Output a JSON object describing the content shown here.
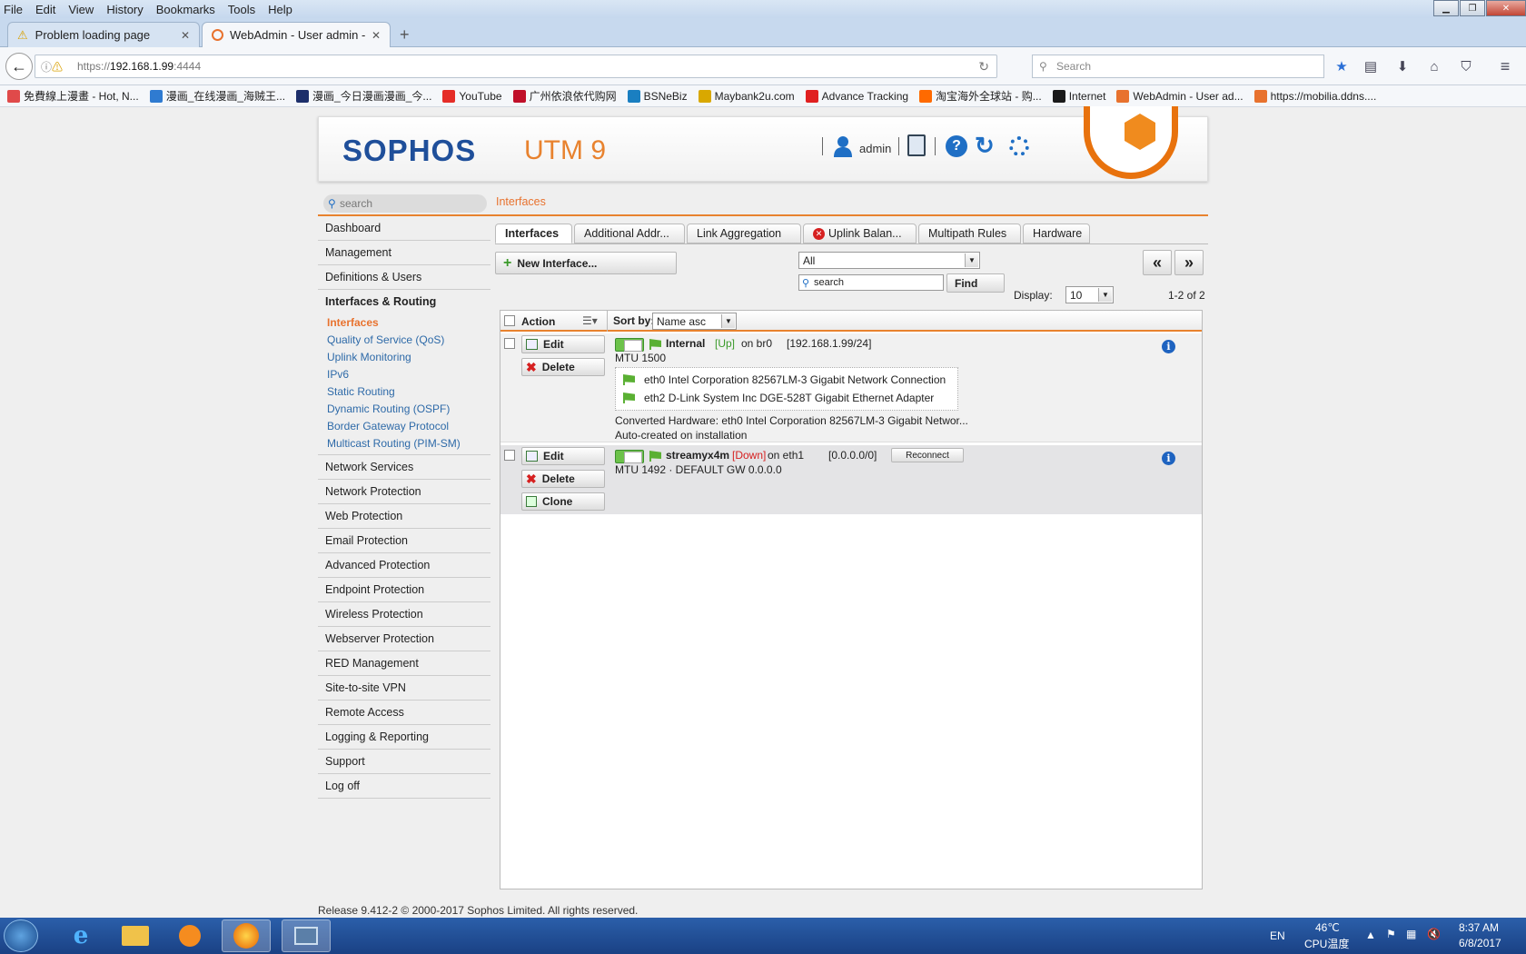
{
  "browser": {
    "menu": [
      "File",
      "Edit",
      "View",
      "History",
      "Bookmarks",
      "Tools",
      "Help"
    ],
    "tabs": [
      {
        "label": "Problem loading page"
      },
      {
        "label": "WebAdmin - User admin - D"
      }
    ],
    "url": {
      "scheme": "https://",
      "host": "192.168.1.99",
      "port": ":4444"
    },
    "search_placeholder": "Search",
    "bookmarks": [
      {
        "label": "免費線上漫畫 - Hot, N...",
        "color": "#e04a4a"
      },
      {
        "label": "漫画_在线漫画_海贼王...",
        "color": "#2f7bd1"
      },
      {
        "label": "漫画_今日漫画漫画_今...",
        "color": "#1d2f6b"
      },
      {
        "label": "YouTube",
        "color": "#e52d27"
      },
      {
        "label": "广州依浪依代购网",
        "color": "#c0102a"
      },
      {
        "label": "BSNeBiz",
        "color": "#1a7fc1"
      },
      {
        "label": "Maybank2u.com",
        "color": "#d9a800"
      },
      {
        "label": "Advance Tracking",
        "color": "#e02020"
      },
      {
        "label": "淘宝海外全球站 - 购...",
        "color": "#ff6a00"
      },
      {
        "label": "Internet",
        "color": "#1a1a1a"
      },
      {
        "label": "WebAdmin - User ad...",
        "color": "#e8722e"
      },
      {
        "label": "https://mobilia.ddns....",
        "color": "#e8722e"
      }
    ]
  },
  "header": {
    "logo": "SOPHOS",
    "product": "UTM 9",
    "user": "admin"
  },
  "sidebar": {
    "search_placeholder": "search",
    "items_top": [
      "Dashboard",
      "Management",
      "Definitions & Users"
    ],
    "section": "Interfaces & Routing",
    "subitems": [
      "Interfaces",
      "Quality of Service (QoS)",
      "Uplink Monitoring",
      "IPv6",
      "Static Routing",
      "Dynamic Routing (OSPF)",
      "Border Gateway Protocol",
      "Multicast Routing (PIM-SM)"
    ],
    "items_bottom": [
      "Network Services",
      "Network Protection",
      "Web Protection",
      "Email Protection",
      "Advanced Protection",
      "Endpoint Protection",
      "Wireless Protection",
      "Webserver Protection",
      "RED Management",
      "Site-to-site VPN",
      "Remote Access",
      "Logging & Reporting",
      "Support",
      "Log off"
    ]
  },
  "breadcrumb": "Interfaces",
  "tabs": [
    "Interfaces",
    "Additional Addr...",
    "Link Aggregation",
    "Uplink Balan...",
    "Multipath Rules",
    "Hardware"
  ],
  "toolbar": {
    "new_label": "New Interface...",
    "filter_value": "All",
    "search_placeholder": "search",
    "find_label": "Find",
    "display_label": "Display:",
    "display_value": "10",
    "count": "1-2 of 2",
    "prev": "«",
    "next": "»"
  },
  "grid": {
    "action_header": "Action",
    "sort_label": "Sort by:",
    "sort_value": "Name asc",
    "edit": "Edit",
    "delete": "Delete",
    "clone": "Clone",
    "rows": [
      {
        "name": "Internal",
        "status": "[Up]",
        "on": "on br0",
        "addr": "[192.168.1.99/24]",
        "mtu": "MTU 1500",
        "hw": [
          "eth0 Intel Corporation 82567LM-3 Gigabit Network Connection",
          "eth2 D-Link System Inc DGE-528T Gigabit Ethernet Adapter"
        ],
        "converted": "Converted Hardware: eth0 Intel Corporation 82567LM-3 Gigabit Networ...",
        "note": "Auto-created on installation"
      },
      {
        "name": "streamyx4m",
        "status": "[Down]",
        "on": "on eth1",
        "addr": "[0.0.0.0/0]",
        "reconnect": "Reconnect",
        "mtu": "MTU 1492 · DEFAULT GW 0.0.0.0"
      }
    ]
  },
  "footer": "Release 9.412-2  © 2000-2017 Sophos Limited. All rights reserved.",
  "taskbar": {
    "lang": "EN",
    "temp": "46℃",
    "temp_label": "CPU温度",
    "time": "8:37 AM",
    "date": "6/8/2017"
  },
  "colors": {
    "accent": "#e8822e",
    "brand": "#1f4f9a",
    "up": "#3a9a2a",
    "down": "#d62020",
    "link": "#2e6aa8"
  }
}
